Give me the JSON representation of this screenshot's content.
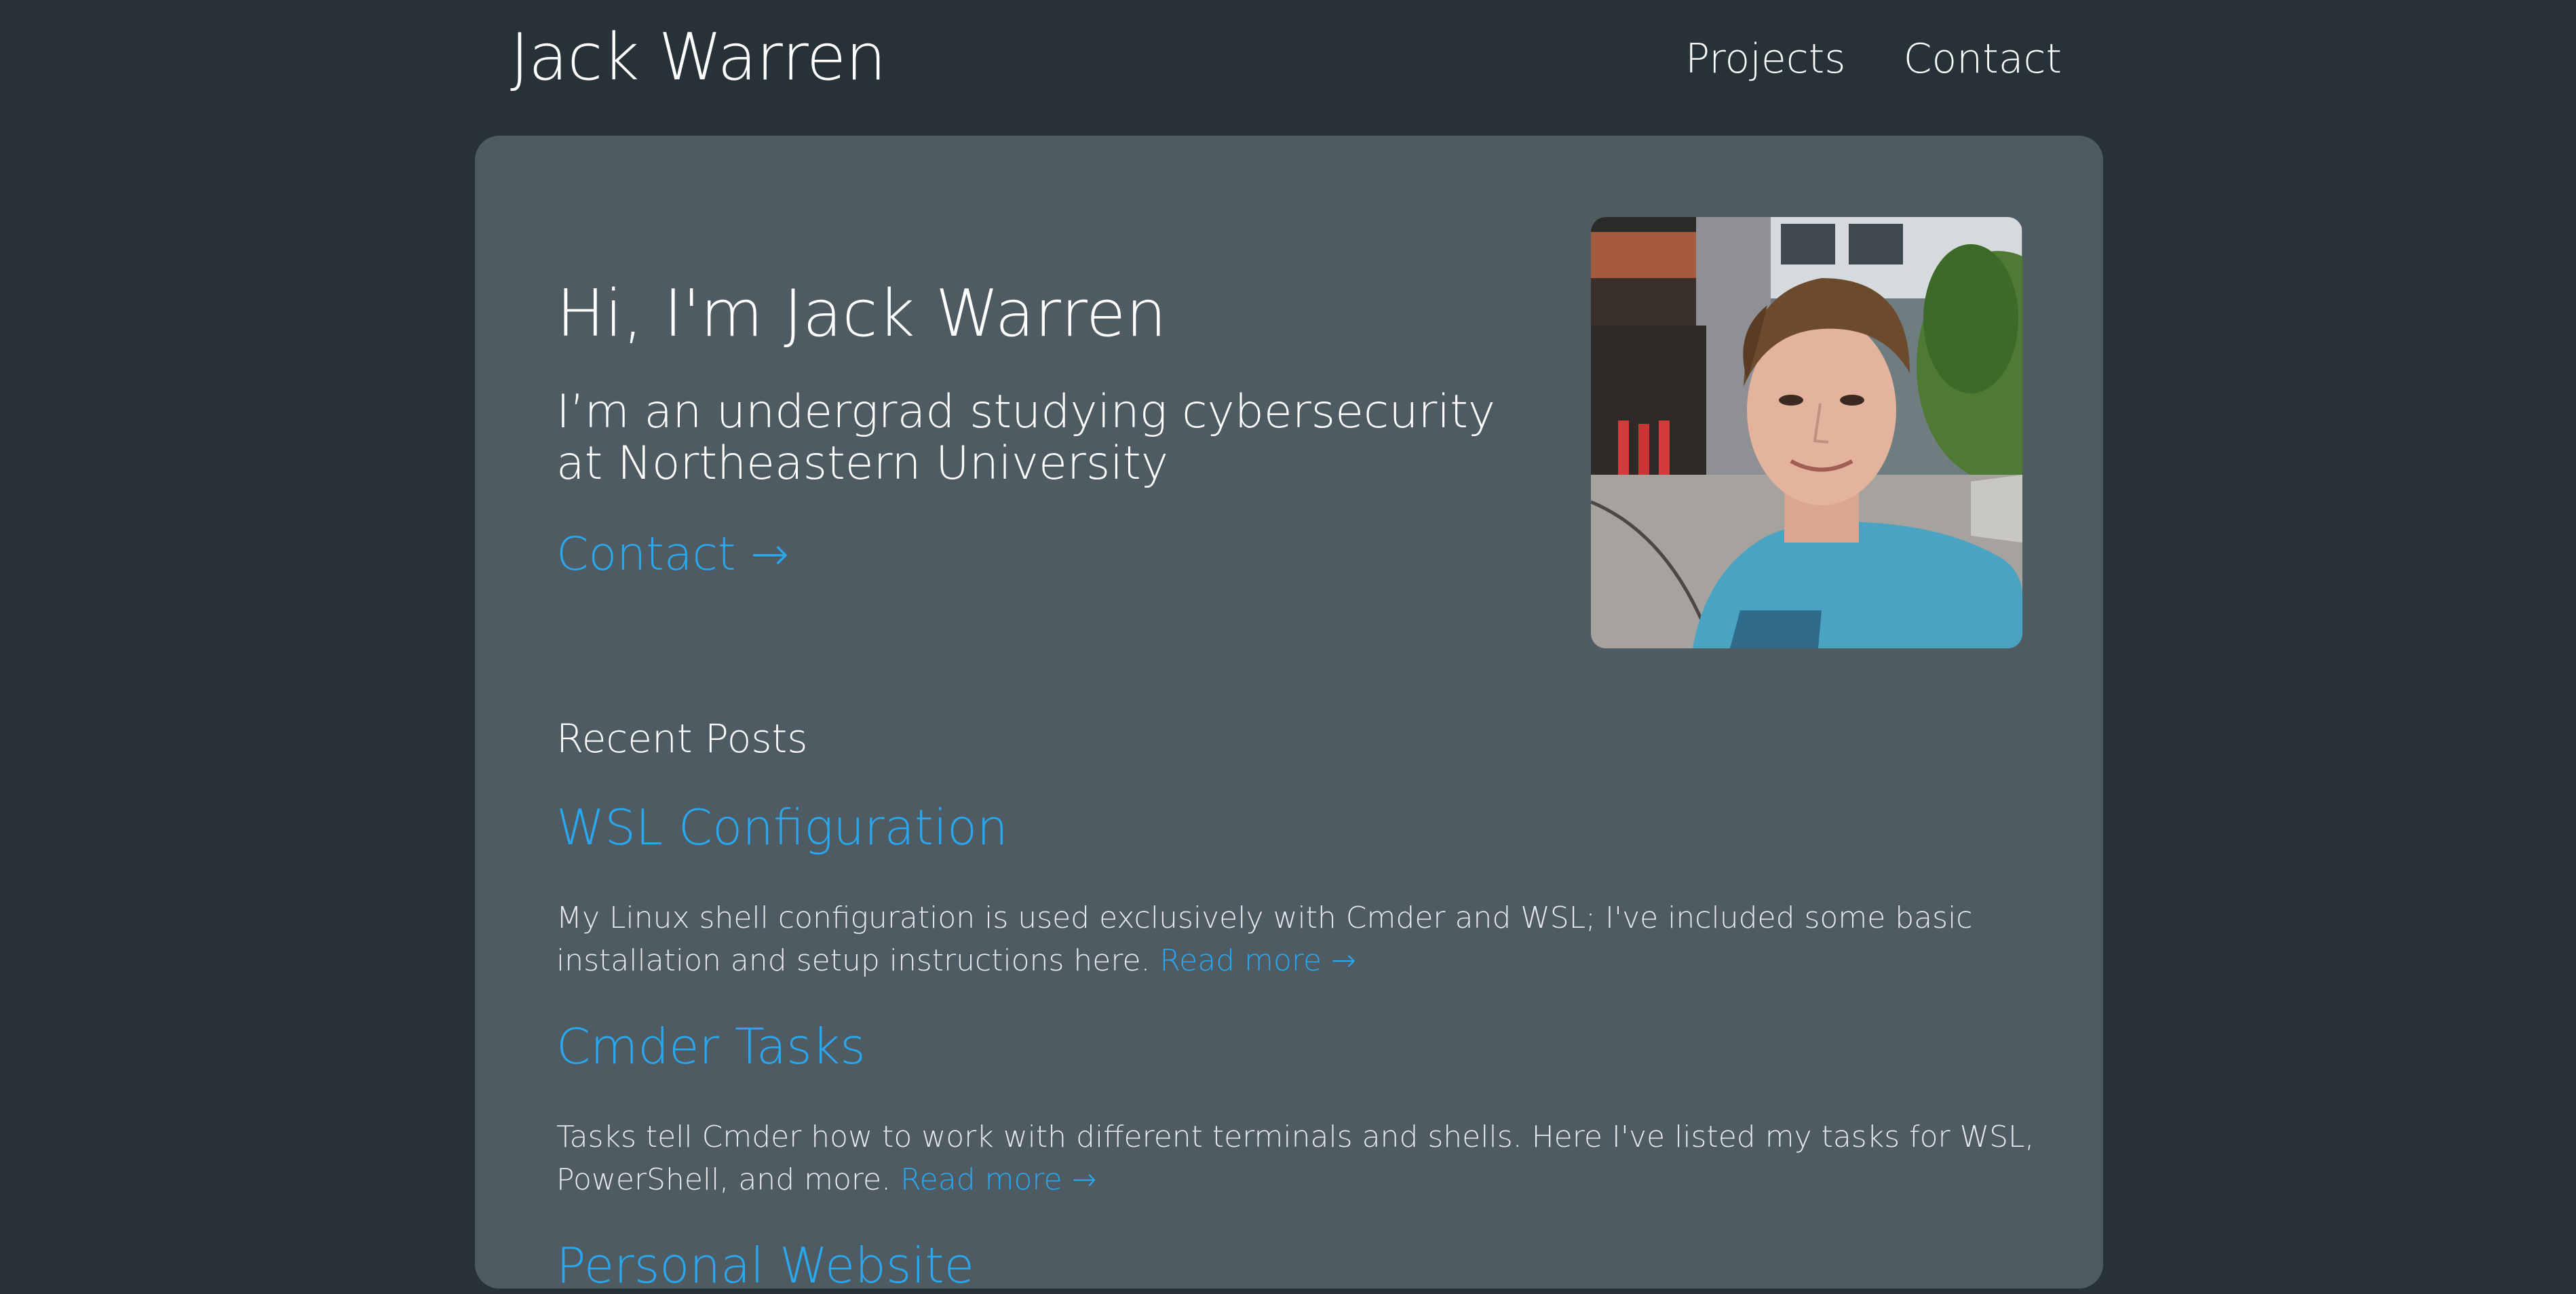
{
  "header": {
    "site_title": "Jack Warren",
    "nav": [
      {
        "label": "Projects"
      },
      {
        "label": "Contact"
      }
    ]
  },
  "hero": {
    "heading": "Hi, I'm Jack Warren",
    "subheading": "I’m an undergrad studying cybersecurity at Northeastern University",
    "contact_link": "Contact →"
  },
  "recent_posts": {
    "heading": "Recent Posts",
    "posts": [
      {
        "title": "WSL Configuration",
        "description": "My Linux shell configuration is used exclusively with Cmder and WSL; I've included some basic installation and setup instructions here.",
        "read_more": "Read more →"
      },
      {
        "title": "Cmder Tasks",
        "description": "Tasks tell Cmder how to work with different terminals and shells. Here I've listed my tasks for WSL, PowerShell, and more.",
        "read_more": "Read more →"
      },
      {
        "title": "Personal Website"
      }
    ]
  },
  "colors": {
    "page_background": "#263238",
    "card_background": "#4f5b62",
    "link": "#29a8f0"
  }
}
